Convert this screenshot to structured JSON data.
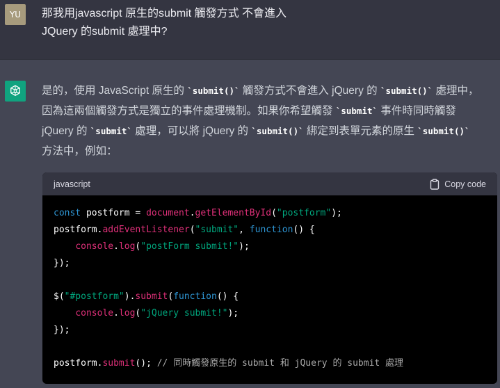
{
  "user": {
    "avatar_initials": "YU",
    "message_lines": [
      "那我用javascript 原生的submit 觸發方式 不會進入",
      "JQuery 的submit 處理中?"
    ]
  },
  "assistant": {
    "avatar_icon": "openai-logo-icon",
    "answer": {
      "l1_a": "是的，使用 JavaScript 原生的 ",
      "c1": "`submit()`",
      "l1_b": " 觸發方式不會進入 jQuery 的 ",
      "c2": "`submit()`",
      "l1_c": " 處理中，",
      "l2_a": "因為這兩個觸發方式是獨立的事件處理機制。如果你希望觸發 ",
      "c3": "`submit`",
      "l2_b": " 事件時同時觸發",
      "l3_a": "jQuery 的 ",
      "c4": "`submit`",
      "l3_b": " 處理，可以將 jQuery 的 ",
      "c5": "`submit()`",
      "l3_c": " 綁定到表單元素的原生 ",
      "c6": "`submit()`",
      "l4": "方法中，例如："
    },
    "code": {
      "language": "javascript",
      "copy_label": "Copy code",
      "tokens": {
        "l1": [
          "const",
          " postform = ",
          "document",
          ".",
          "getElementById",
          "(",
          "\"postform\"",
          ");"
        ],
        "l2": [
          "postform.",
          "addEventListener",
          "(",
          "\"submit\"",
          ", ",
          "function",
          "() {"
        ],
        "l3": [
          "    ",
          "console",
          ".",
          "log",
          "(",
          "\"postForm submit!\"",
          ");"
        ],
        "l4": "});",
        "l5": [
          "$(",
          "\"#postform\"",
          ").",
          "submit",
          "(",
          "function",
          "() {"
        ],
        "l6": [
          "    ",
          "console",
          ".",
          "log",
          "(",
          "\"jQuery submit!\"",
          ");"
        ],
        "l7": "});",
        "l8": [
          "postform.",
          "submit",
          "(); ",
          "// 同時觸發原生的 submit 和 jQuery 的 submit 處理"
        ]
      }
    }
  },
  "colors": {
    "user_bg": "#343541",
    "assistant_bg": "#444654",
    "code_bg": "#000000",
    "keyword": "#2e95d3",
    "function": "#df3079",
    "string": "#00a67d",
    "comment": "#a8a8a8",
    "gpt_avatar": "#10a37f"
  }
}
